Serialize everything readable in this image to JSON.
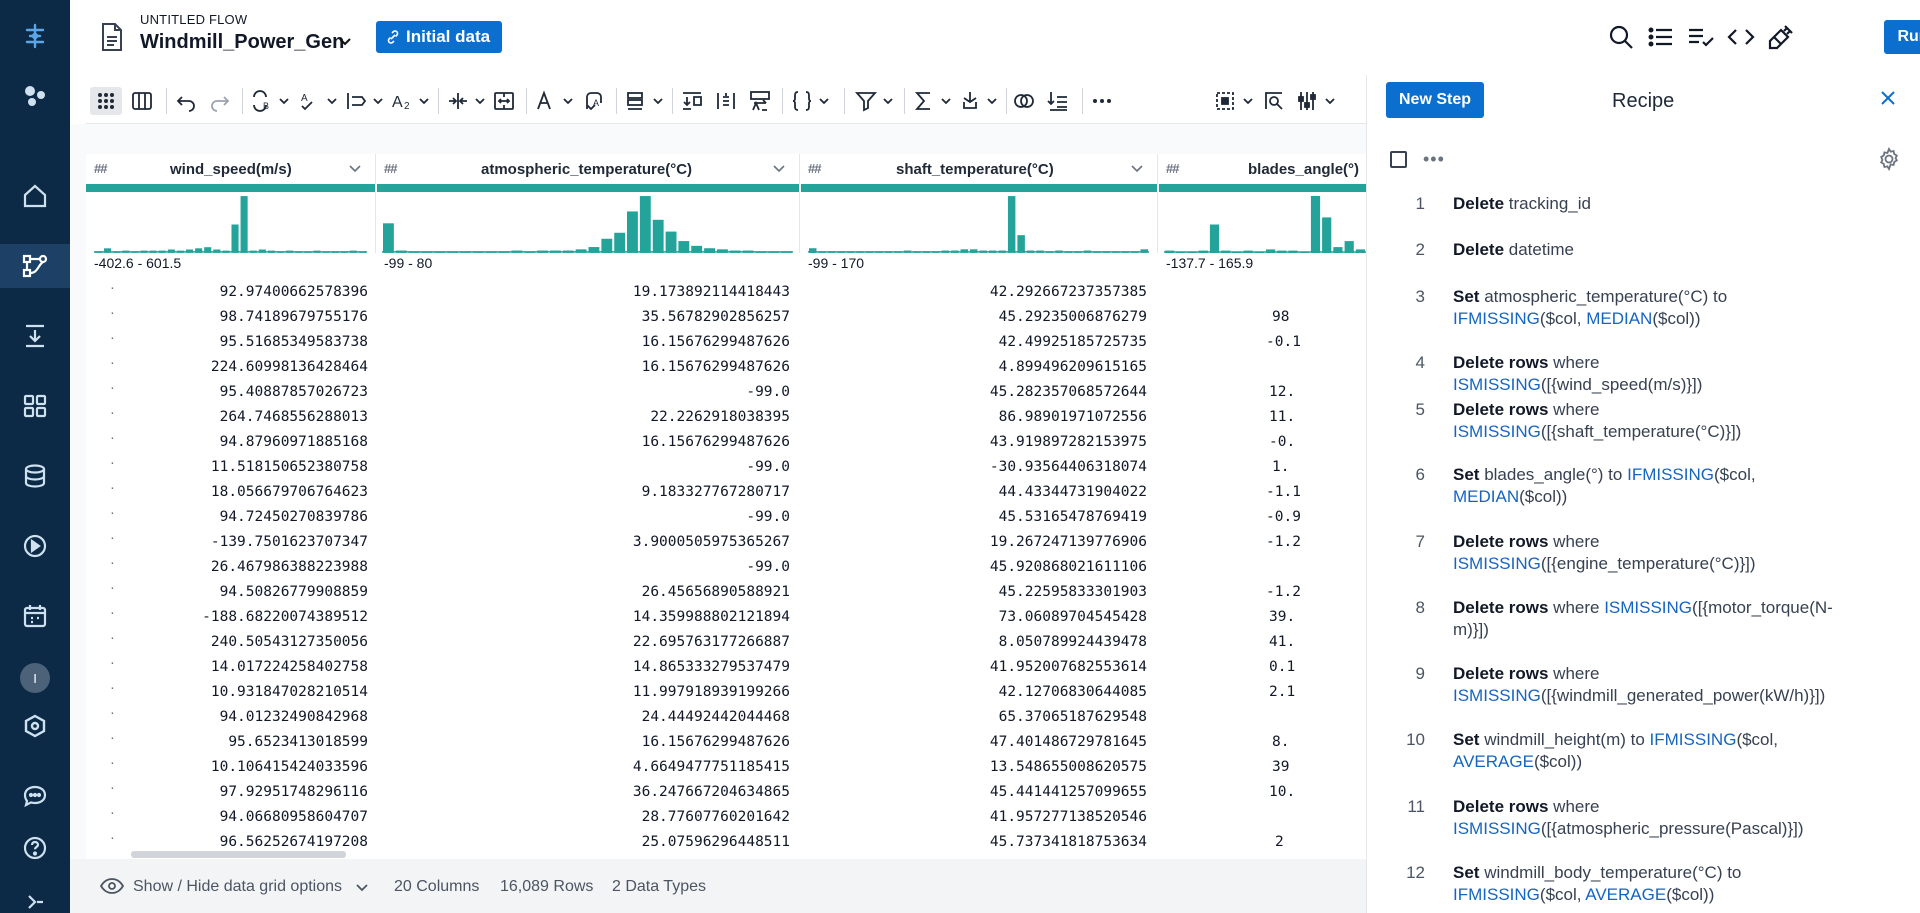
{
  "app": {
    "flow_caption": "UNTITLED FLOW",
    "flow_name": "Windmill_Power_Gen",
    "initial_data_label": "Initial data",
    "run_label": "Run"
  },
  "grid": {
    "columns": [
      {
        "type_icon": "##",
        "name": "wind_speed(m/s)",
        "range": "-402.6 - 601.5",
        "hist": [
          0,
          4,
          0,
          2,
          1,
          2,
          2,
          2,
          3,
          2,
          3,
          4,
          5,
          3,
          2,
          25,
          50,
          2,
          3,
          2,
          1,
          2,
          1,
          1,
          2,
          1,
          1,
          1,
          2,
          1
        ]
      },
      {
        "type_icon": "##",
        "name": "atmospheric_temperature(°C)",
        "range": "-99 - 80",
        "hist": [
          25,
          2,
          1,
          1,
          1,
          1,
          1,
          1,
          1,
          1,
          2,
          1,
          2,
          2,
          2,
          3,
          5,
          12,
          17,
          35,
          48,
          28,
          18,
          10,
          6,
          4,
          3,
          2,
          2,
          1,
          1,
          1
        ]
      },
      {
        "type_icon": "##",
        "name": "shaft_temperature(°C)",
        "range": "-99 - 170",
        "hist": [
          4,
          1,
          1,
          1,
          1,
          1,
          1,
          1,
          1,
          1,
          2,
          1,
          1,
          1,
          2,
          2,
          3,
          3,
          2,
          2,
          2,
          48,
          15,
          2,
          2,
          1,
          2,
          1,
          1,
          2,
          1,
          1,
          1,
          1,
          1,
          3
        ]
      },
      {
        "type_icon": "##",
        "name": "blades_angle(°)",
        "range": "-137.7 - 165.9",
        "hist": [
          2,
          0,
          1,
          2,
          24,
          2,
          1,
          2,
          1,
          3,
          2,
          2,
          1,
          48,
          30,
          5,
          10,
          3
        ]
      }
    ],
    "rows": [
      [
        "92.97400662578396",
        "19.173892114418443",
        "42.292667237357385",
        ""
      ],
      [
        "98.74189679755176",
        "35.56782902856257",
        "45.29235006876279",
        "98"
      ],
      [
        "95.51685349583738",
        "16.15676299487626",
        "42.49925185725735",
        "-0.1"
      ],
      [
        "224.60998136428464",
        "16.15676299487626",
        "4.899496209615165",
        ""
      ],
      [
        "95.40887857026723",
        "-99.0",
        "45.282357068572644",
        "12."
      ],
      [
        "264.7468556288013",
        "22.2262918038395",
        "86.98901971072556",
        "11."
      ],
      [
        "94.87960971885168",
        "16.15676299487626",
        "43.919897282153975",
        "-0."
      ],
      [
        "11.518150652380758",
        "-99.0",
        "-30.93564406318074",
        "1."
      ],
      [
        "18.056679706764623",
        "9.183327767280717",
        "44.43344731904022",
        "-1.1"
      ],
      [
        "94.72450270839786",
        "-99.0",
        "45.53165478769419",
        "-0.9"
      ],
      [
        "-139.7501623707347",
        "3.9000505975365267",
        "19.267247139776906",
        "-1.2"
      ],
      [
        "26.467986388223988",
        "-99.0",
        "45.920868021611106",
        ""
      ],
      [
        "94.50826779908859",
        "26.45656890588921",
        "45.22595833301903",
        "-1.2"
      ],
      [
        "-188.68220074389512",
        "14.359988802121894",
        "73.06089704545428",
        "39."
      ],
      [
        "240.50543127350056",
        "22.695763177266887",
        "8.050789924439478",
        "41."
      ],
      [
        "14.017224258402758",
        "14.865333279537479",
        "41.952007682553614",
        "0.1"
      ],
      [
        "10.931847028210514",
        "11.997918939199266",
        "42.12706830644085",
        "2.1"
      ],
      [
        "94.01232490842968",
        "24.44492442044468",
        "65.37065187629548",
        ""
      ],
      [
        "95.6523413018599",
        "16.15676299487626",
        "47.401486729781645",
        "8."
      ],
      [
        "10.106415424033596",
        "4.6649477751185415",
        "13.548655008620575",
        "39"
      ],
      [
        "97.92951748296116",
        "36.247667204634865",
        "45.441441257099655",
        "10."
      ],
      [
        "94.06680958604707",
        "28.77607760201642",
        "41.957277138520546",
        ""
      ],
      [
        "96.56252674197208",
        "25.07596296448511",
        "45.737341818753634",
        "2"
      ]
    ]
  },
  "status": {
    "toggle_label": "Show / Hide data grid options",
    "columns": "20 Columns",
    "rows": "16,089 Rows",
    "types": "2 Data Types"
  },
  "recipe": {
    "new_step_label": "New Step",
    "title": "Recipe",
    "steps": [
      {
        "num": "1",
        "parts": [
          [
            "kw",
            "Delete"
          ],
          [
            "t",
            " tracking_id"
          ]
        ]
      },
      {
        "num": "2",
        "parts": [
          [
            "kw",
            "Delete"
          ],
          [
            "t",
            " datetime"
          ]
        ]
      },
      {
        "num": "3",
        "parts": [
          [
            "kw",
            "Set"
          ],
          [
            "t",
            " atmospheric_temperature(°C) to "
          ],
          [
            "fn",
            "IFMISSING"
          ],
          [
            "t",
            "($col, "
          ],
          [
            "fn",
            "MEDIAN"
          ],
          [
            "t",
            "($col))"
          ]
        ]
      },
      {
        "num": "4",
        "parts": [
          [
            "kw",
            "Delete rows"
          ],
          [
            "t",
            " where "
          ],
          [
            "fn",
            "ISMISSING"
          ],
          [
            "t",
            "([{wind_speed(m/s)}])"
          ]
        ]
      },
      {
        "num": "5",
        "parts": [
          [
            "kw",
            "Delete rows"
          ],
          [
            "t",
            " where "
          ],
          [
            "fn",
            "ISMISSING"
          ],
          [
            "t",
            "([{shaft_temperature(°C)}])"
          ]
        ]
      },
      {
        "num": "6",
        "parts": [
          [
            "kw",
            "Set"
          ],
          [
            "t",
            " blades_angle(°) to "
          ],
          [
            "fn",
            "IFMISSING"
          ],
          [
            "t",
            "($col, "
          ],
          [
            "fn",
            "MEDIAN"
          ],
          [
            "t",
            "($col))"
          ]
        ]
      },
      {
        "num": "7",
        "parts": [
          [
            "kw",
            "Delete rows"
          ],
          [
            "t",
            " where "
          ],
          [
            "fn",
            "ISMISSING"
          ],
          [
            "t",
            "([{engine_temperature(°C)}])"
          ]
        ]
      },
      {
        "num": "8",
        "parts": [
          [
            "kw",
            "Delete rows"
          ],
          [
            "t",
            " where "
          ],
          [
            "fn",
            "ISMISSING"
          ],
          [
            "t",
            "([{motor_torque(N-m)}])"
          ]
        ]
      },
      {
        "num": "9",
        "parts": [
          [
            "kw",
            "Delete rows"
          ],
          [
            "t",
            " where "
          ],
          [
            "fn",
            "ISMISSING"
          ],
          [
            "t",
            "([{windmill_generated_power(kW/h)}])"
          ]
        ]
      },
      {
        "num": "10",
        "parts": [
          [
            "kw",
            "Set"
          ],
          [
            "t",
            " windmill_height(m) to "
          ],
          [
            "fn",
            "IFMISSING"
          ],
          [
            "t",
            "($col, "
          ],
          [
            "fn",
            "AVERAGE"
          ],
          [
            "t",
            "($col))"
          ]
        ]
      },
      {
        "num": "11",
        "parts": [
          [
            "kw",
            "Delete rows"
          ],
          [
            "t",
            " where "
          ],
          [
            "fn",
            "ISMISSING"
          ],
          [
            "t",
            "([{atmospheric_pressure(Pascal)}])"
          ]
        ]
      },
      {
        "num": "12",
        "parts": [
          [
            "kw",
            "Set"
          ],
          [
            "t",
            " windmill_body_temperature(°C) to "
          ],
          [
            "fn",
            "IFMISSING"
          ],
          [
            "t",
            "($col, "
          ],
          [
            "fn",
            "AVERAGE"
          ],
          [
            "t",
            "($col))"
          ]
        ]
      }
    ]
  },
  "colors": {
    "sidebar": "#0c2a45",
    "accent": "#0b6fcf",
    "column_bar": "#24a39b"
  }
}
